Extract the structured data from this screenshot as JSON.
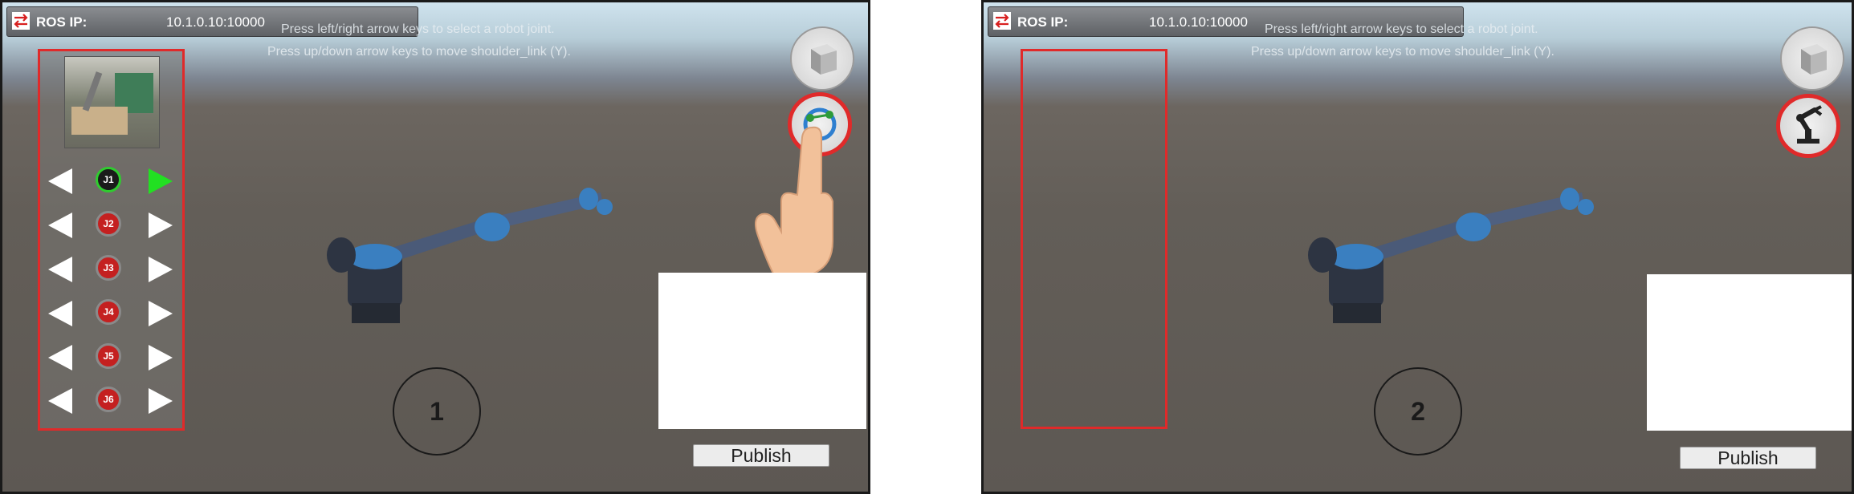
{
  "panels": [
    {
      "topbar": {
        "label": "ROS IP:",
        "value": "10.1.0.10:10000"
      },
      "hints": [
        "Press left/right arrow keys to select a robot joint.",
        "Press up/down arrow keys to move shoulder_link (Y)."
      ],
      "joints": [
        "J1",
        "J2",
        "J3",
        "J4",
        "J5",
        "J6"
      ],
      "active_joint": "J1",
      "publish_label": "Publish",
      "step_number": "1",
      "selected_view_icon": "joint-control-icon"
    },
    {
      "topbar": {
        "label": "ROS IP:",
        "value": "10.1.0.10:10000"
      },
      "hints": [
        "Press left/right arrow keys to select a robot joint.",
        "Press up/down arrow keys to move shoulder_link (Y)."
      ],
      "publish_label": "Publish",
      "step_number": "2",
      "selected_view_icon": "robot-arm-icon"
    }
  ],
  "colors": {
    "highlight": "#e02a2a",
    "active_joint": "#2fcc2f",
    "joint_badge": "#c42020",
    "robot_arm": "#4a5a78",
    "robot_joint": "#3a7fc0"
  }
}
